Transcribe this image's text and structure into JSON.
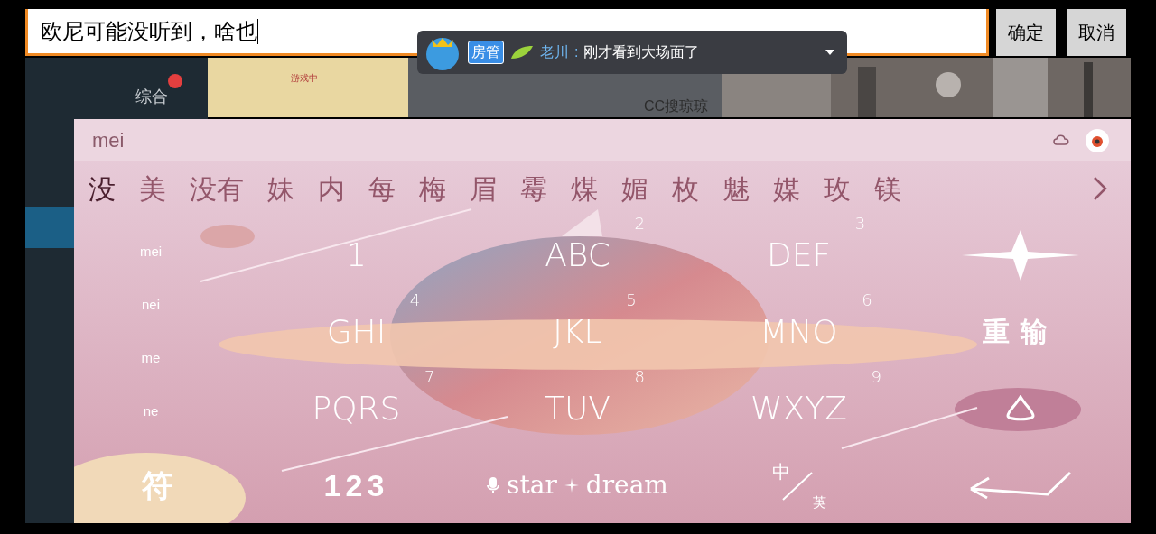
{
  "input": {
    "value": "欧尼可能没听到，啥也"
  },
  "buttons": [
    "确定",
    "取消"
  ],
  "chat_popup": {
    "badge": "房管",
    "user": "老川",
    "separator": ":",
    "message": "刚才看到大场面了"
  },
  "background_app": {
    "tab": "综合",
    "status": "游戏中",
    "streamer": "CC搜琼琼"
  },
  "keyboard": {
    "composition": "mei",
    "candidates": [
      {
        "text": "没",
        "selected": true
      },
      {
        "text": "美",
        "selected": false
      },
      {
        "text": "没有",
        "selected": false
      },
      {
        "text": "妹",
        "selected": false
      },
      {
        "text": "内",
        "selected": false
      },
      {
        "text": "每",
        "selected": false
      },
      {
        "text": "梅",
        "selected": false
      },
      {
        "text": "眉",
        "selected": false
      },
      {
        "text": "霉",
        "selected": false
      },
      {
        "text": "煤",
        "selected": false
      },
      {
        "text": "媚",
        "selected": false
      },
      {
        "text": "枚",
        "selected": false
      },
      {
        "text": "魅",
        "selected": false
      },
      {
        "text": "媒",
        "selected": false
      },
      {
        "text": "玫",
        "selected": false
      },
      {
        "text": "镁",
        "selected": false
      }
    ],
    "pinyin_options": [
      "mei",
      "nei",
      "me",
      "ne"
    ],
    "keys": [
      {
        "label": "1"
      },
      {
        "label": "ABC",
        "digit": "2"
      },
      {
        "label": "DEF",
        "digit": "3"
      },
      {
        "label": "GHI",
        "digit": "4"
      },
      {
        "label": "JKL",
        "digit": "5"
      },
      {
        "label": "MNO",
        "digit": "6"
      },
      {
        "label": "PQRS",
        "digit": "7"
      },
      {
        "label": "TUV",
        "digit": "8"
      },
      {
        "label": "WXYZ",
        "digit": "9"
      }
    ],
    "side_keys": [
      {
        "kind": "delete"
      },
      {
        "kind": "text",
        "label": "重输"
      },
      {
        "kind": "droplet"
      }
    ],
    "bottom_keys": [
      {
        "kind": "text",
        "label": "符"
      },
      {
        "kind": "text",
        "label": "123"
      },
      {
        "kind": "space",
        "words": [
          "star",
          "dream"
        ]
      },
      {
        "kind": "lang",
        "labels": [
          "中",
          "英"
        ]
      },
      {
        "kind": "enter"
      }
    ]
  }
}
